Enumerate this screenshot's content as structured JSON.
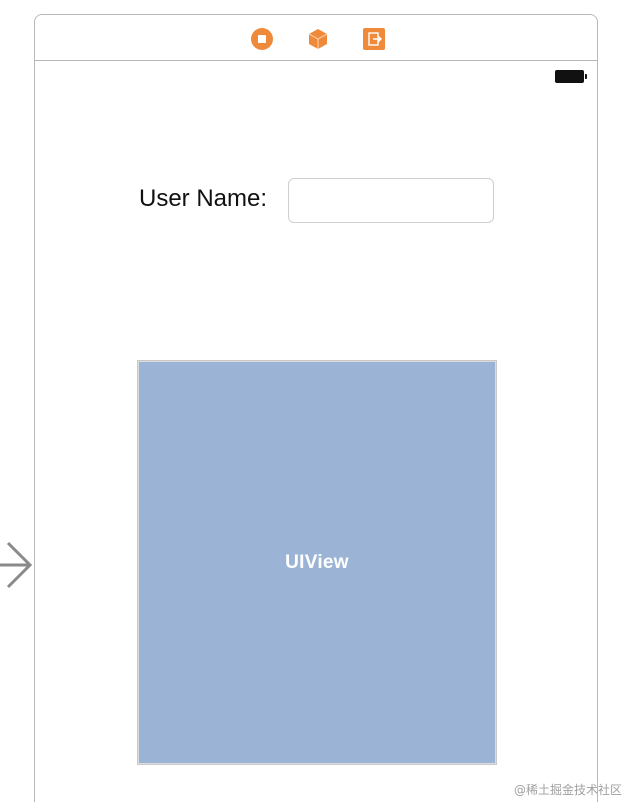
{
  "scene": {
    "dock_icons": [
      "view-controller-icon",
      "first-responder-icon",
      "exit-icon"
    ],
    "accent_color": "#f08a3b",
    "battery_icon": "battery-full-icon"
  },
  "form": {
    "user_name_label": "User Name:",
    "user_name_value": "",
    "user_name_placeholder": ""
  },
  "uiview": {
    "label": "UIView",
    "background_color": "#9bb4d6"
  },
  "entry_point": {
    "icon": "storyboard-entry-arrow-icon"
  },
  "watermark": {
    "text": "@稀土掘金技术社区"
  }
}
